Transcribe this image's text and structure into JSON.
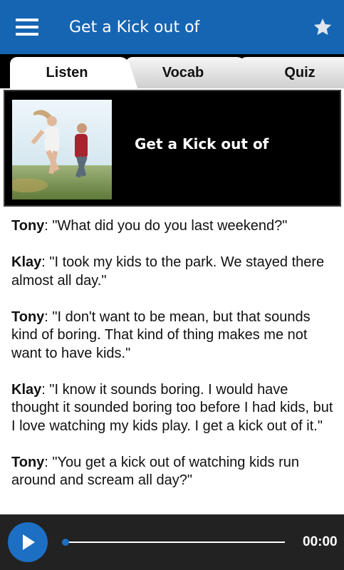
{
  "header": {
    "title": "Get a Kick out of"
  },
  "tabs": [
    {
      "label": "Listen",
      "active": true
    },
    {
      "label": "Vocab",
      "active": false
    },
    {
      "label": "Quiz",
      "active": false
    }
  ],
  "hero": {
    "title": "Get a Kick out of"
  },
  "transcript": [
    {
      "speaker": "Tony",
      "text": ": \"What did you do you last weekend?\""
    },
    {
      "speaker": "Klay",
      "text": ": \"I took my kids to the park.  We stayed there almost all day.\""
    },
    {
      "speaker": "Tony",
      "text": ": \"I don't want to be mean, but that sounds kind of boring.  That kind of thing makes me not want to have kids.\""
    },
    {
      "speaker": "Klay",
      "text": ": \"I know it sounds boring.  I would have thought it sounded boring too before I had kids, but I love watching my kids play.  I get a kick out of it.\""
    },
    {
      "speaker": "Tony",
      "text": ": \"You get a kick out of watching kids run around and scream all day?\""
    }
  ],
  "player": {
    "time": "00:00",
    "progress": 0
  },
  "colors": {
    "appbar": "#1565b3",
    "accent": "#1d6fc4",
    "player_bg": "#222222"
  },
  "icons": {
    "menu": "hamburger-menu-icon",
    "favorite": "star-icon",
    "play": "play-icon"
  }
}
